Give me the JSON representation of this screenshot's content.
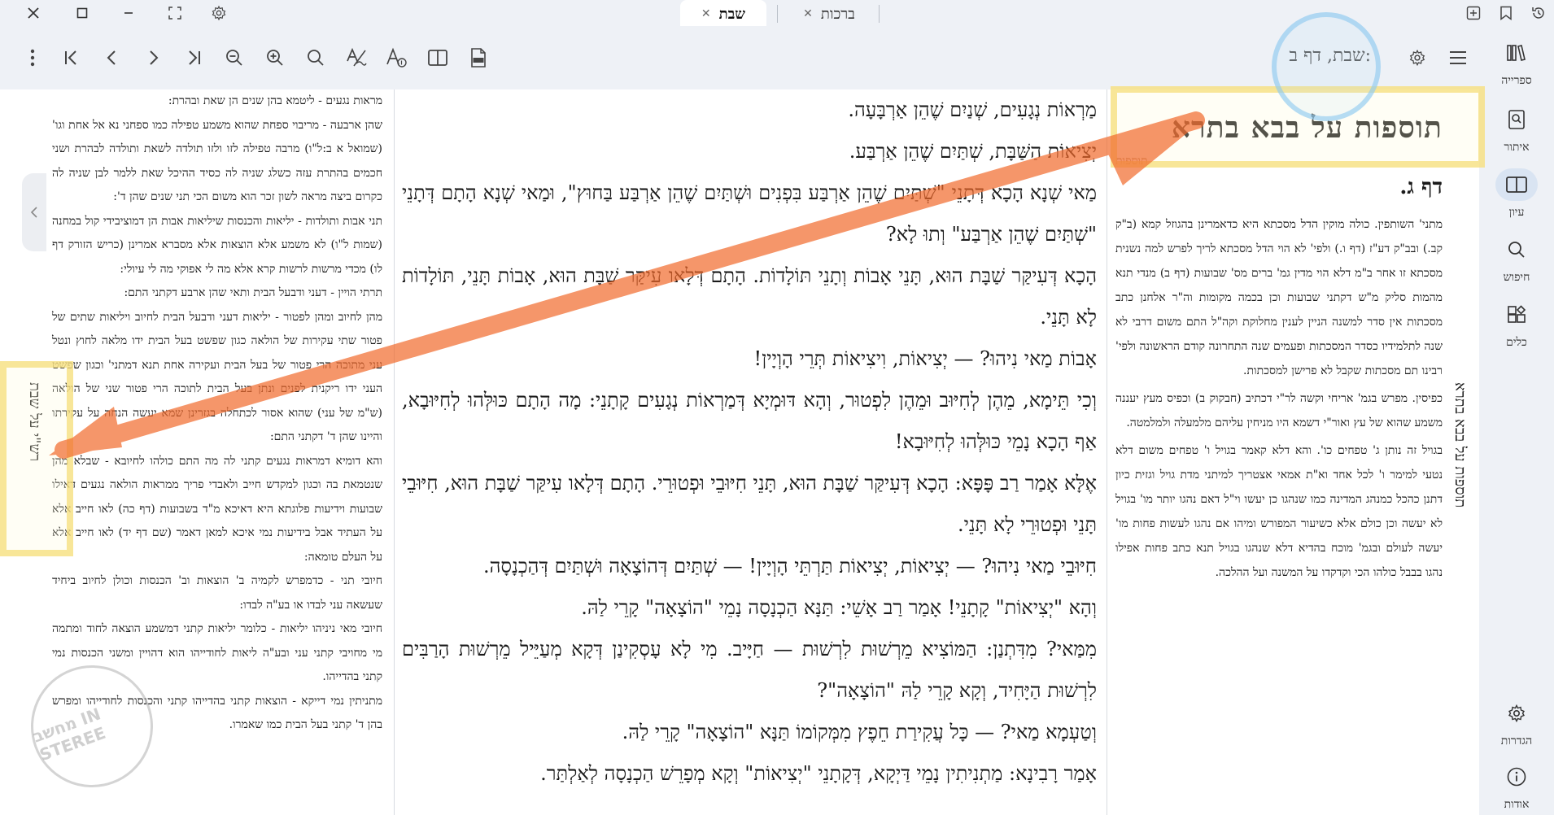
{
  "tabs": [
    {
      "label": "שבת",
      "active": true
    },
    {
      "label": "ברכות",
      "active": false
    }
  ],
  "toolbar": {
    "reference": "שבת, דף ב:"
  },
  "sidebar": {
    "items": [
      {
        "label": "ספרייה",
        "icon": "library-icon"
      },
      {
        "label": "איתור",
        "icon": "locate-icon"
      },
      {
        "label": "עיון",
        "icon": "book-open-icon",
        "active": true
      },
      {
        "label": "חיפוש",
        "icon": "search-icon"
      },
      {
        "label": "כלים",
        "icon": "tools-icon"
      },
      {
        "label": "הגדרות",
        "icon": "gear-icon"
      },
      {
        "label": "אודות",
        "icon": "info-icon"
      }
    ]
  },
  "right_pane": {
    "title": "תוספות על בבא בתרא",
    "subtitle": "תוספות",
    "daf": "דף ג.",
    "vertical_label": "תוספות על בבא בתרא",
    "paragraphs": [
      "מתני' השותפין. כולה מוקין הדל מסכתא היא כדאמרינן בהגוזל קמא (ב\"ק קב.) ובב\"ק דע\"ז (דף ו.) ולפי' לא הוי הדל מסכתא לריך לפרש למה נשנית מסכתא זו אחר ב\"מ דלא הוי מדין גמ' ברים מס' שבועות (דף ב) מנדי תנא מהמות סליק מ\"ש דקתני שבועות וכן בכמה מקומות וה\"ר אלחנן כתב מסכתות אין סדר למשנה הניין לענין מחלוקת וקה\"ל התם משום דרבי לא שנה לתלמידיו כסדר המסכתות ופעמים שנה התחרונה קודם הראשונה ולפי' רבינו תם מסכתות שקבל לא פרישן למסכתות.",
      "כפיסין. מפרש בגמ' אריחי וקשה לר\"י דכתיב (חבקוק ב) וכפיס מעץ יעננה משמע שהוא של עץ ואור\"י דשמא היו מניחין עליהם מלמעלה ולמלמטה.",
      "בגויל זה נותן ג' טפחים כו'. והא דלא קאמר בגויל ו' טפחים משום דלא נטעי למימר ו' לכל אחד וא\"ת אמאי אצטריך למיתני מדת גויל וגזית כיון דתנן כהכל כמנהג המדינה כמו שנהגו כן יעשו וי\"ל דאם נהגו יותר מו' בגויל לא יעשה וכן כולם אלא כשיעור המפורש ומיהו אם נהגו לעשות פחות מו' יעשה לעולם ובגמ' מוכח בהדיא דלא שנהגו בגויל תנא כתב פחות אפילו נהגו בבבל כולהו הכי וקדקדו על המשנה ועל ההלכה."
    ]
  },
  "main_pane": {
    "paragraphs": [
      "מַרְאוֹת נְגָעִים, שְׁנַיִם שֶׁהֵן אַרְבָּעָה.",
      "יְצִיאוֹת הַשַּׁבָּת, שְׁתַּיִם שֶׁהֵן אַרְבַּע.",
      "מַאי שְׁנָא הָכָא דְּתָנֵי \"שְׁתַּיִם שֶׁהֵן אַרְבַּע בִּפְנִים וּשְׁתַּיִם שֶׁהֵן אַרְבַּע בַּחוּץ\", וּמַאי שְׁנָא הָתָם דְּתָנֵי \"שְׁתַּיִם שֶׁהֵן אַרְבַּע\" וְתוּ לָא?",
      "הָכָא דְּעִיקַּר שַׁבָּת הוּא, תָּנֵי אָבוֹת וְתָנֵי תּוֹלָדוֹת. הָתָם דְּלָאו עִיקַּר שַׁבָּת הוּא, אָבוֹת תָּנֵי, תּוֹלָדוֹת לָא תָּנֵי.",
      "אָבוֹת מַאי נִיהוּ? — יְצִיאוֹת, וִיצִיאוֹת תְּרֵי הָוְיָין!",
      "וְכִי תֵּימָא, מֵהֶן לְחִיּוּב וּמֵהֶן לִפְטוּר, וְהָא דּוּמְיָא דְּמַרְאוֹת נְגָעִים קָתָנֵי: מָה הָתָם כּוּלְּהוּ לְחִיּוּבָא, אַף הָכָא נָמֵי כּוּלְּהוּ לְחִיּוּבָא!",
      "אֶלָּא אָמַר רַב פָּפָּא: הָכָא דְּעִיקַּר שַׁבָּת הוּא, תָּנֵי חִיּוּבֵי וּפְטוּרֵי. הָתָם דְּלָאו עִיקַּר שַׁבָּת הוּא, חִיּוּבֵי תָּנֵי וּפְטוּרֵי לָא תָּנֵי.",
      "חִיּוּבֵי מַאי נִיהוּ? — יְצִיאוֹת, יְצִיאוֹת תַּרְתֵּי הָוְיָין! — שְׁתַּיִם דְּהוֹצָאָה וּשְׁתַּיִם דְּהַכְנָסָה.",
      "וְהָא \"יְצִיאוֹת\" קָתָנֵי! אָמַר רַב אָשֵׁי: תַּנָּא הַכְנָסָה נָמֵי \"הוֹצָאָה\" קָרֵי לַהּ.",
      "מִמַּאי? מִדִּתְנַן: הַמּוֹצִיא מֵרְשׁוּת לִרְשׁוּת — חַיָּיב. מִי לָא עָסְקִינַן דְּקָא מְעַיֵּיל מֵרְשׁוּת הָרַבִּים לִרְשׁוּת הַיָּחִיד, וְקָא קָרֵי לַהּ \"הוֹצָאָה\"?",
      "וְטַעְמָא מַאי? — כָּל עֲקִירַת חֵפֶץ מִמְּקוֹמוֹ תַּנָּא \"הוֹצָאָה\" קָרֵי לַהּ.",
      "אָמַר רָבִינָא: מַתְנִיתִין נָמֵי דַּיְקָא, דְּקָתָנֵי \"יְצִיאוֹת\" וְקָא מְפָרֵשׁ הַכְנָסָה לְאַלְתַּר."
    ]
  },
  "left_pane": {
    "vertical_label": "רש\"י על שבת",
    "paragraphs": [
      "מראות נגעים - ליטמא בהן שנים הן שאת ובהרת:",
      "שהן ארבעה - מריבוי ספחת שהוא משמע טפילה כמו ספחני נא אל אחת וגו' (שמואל א ב:ל\"ו) מרבה טפילה לזו ולזו תולדה לשאת ותולדה לבהרת ושני חכמים בהתרת עזה כשלג שניה לה כסיד ההיכל שאת ללמר לבן שניה לה כקרום ביצה מראה לשון זכר הוא משום הכי תני שנים שהן ד':",
      "תני אבות ותולדות - יליאות והכנסות שיליאות אבות הן דמוציבידי קול במחנה (שמות ל\"ו) לא משמע אלא הוצאות אלא מסברא אמרינן (כריש הזורק דף לו) מכדי מרשות לרשות קרא אלא מה לי אפוקי מה לי עיולי:",
      "תרתי הויין - דעני ודבעל הבית ותאי שהן ארבע דקתני התם:",
      "מהן לחיוב ומהן לפטור - יליאות דעני ודבעל הבית לחיוב ויליאות שתים של פטור שתי עקירות של הולאה כגון שפשט בעל הבית ידו מלאה לחוץ ונטל עני מתוכה הרי פטור של בעל הבית ועקירה אחת תנא דמתני' וכגון שפשט העני ידו ריקנית לפנים ונתן בעל הבית לתוכה הרי פטור שני של הולאה (ש\"מ של עני) שהוא אסור לכתחלה בגזרינן שמא יעשה הנחה על עקירתו והיינו שהן ד' דקתני התם:",
      "והא דומיא דמראות נגעים קתני לה מה התם כולהו לחיובא - שבלא מהן שנטמאת בה וכגון למקדש חייב ולאבדי פריך ממראות הולאה נגעים דאילו שבועות וידיעות פלוגתא היא דאיכא מ\"ד בשבועות (דף כה) לאו חייב אלא על העתיד אבל בידיעות נמי איכא למאן דאמר (שם דף יד) לאו חייב אלא על העלם טומאה:",
      "חיובי תני - כדמפרש לקמיה ב' הוצאות וב' הכנסות וכולן לחיוב ביחיד שעשאה עני לבדו או בע\"ה לבדו:",
      "חיובי מאי ניניהו יליאות - כלומר יליאות קתני דמשמע הוצאה לחוד ומתמה מי מחויבי קתני עני ובע\"ה ליאות לחודייהו הוא דהויין ומשני הכנסות נמי קתני בהדייהו.",
      "מתניתין נמי דייקא - הוצאות קתני בהדייהו קתני והכנסות לחודייהו ומפרש בהן ד' קתני בעל הבית כמו שאמרו."
    ]
  },
  "watermark": "מחשב IN STEREE"
}
